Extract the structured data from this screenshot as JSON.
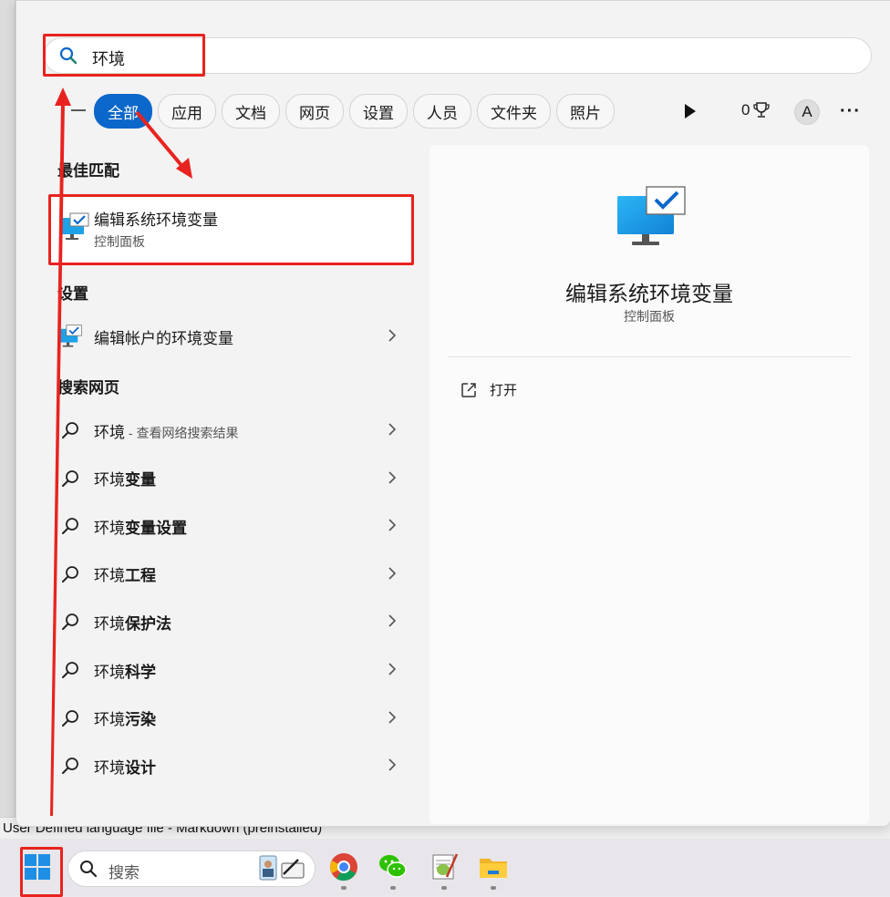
{
  "search": {
    "query": "环境"
  },
  "filters": {
    "back_icon": "back-arrow-icon",
    "chips": [
      "全部",
      "应用",
      "文档",
      "网页",
      "设置",
      "人员",
      "文件夹",
      "照片"
    ],
    "points": "0",
    "avatar": "A",
    "more": "···"
  },
  "sections": {
    "best": "最佳匹配",
    "settings": "设置",
    "web": "搜索网页"
  },
  "best_match": {
    "title": "编辑系统环境变量",
    "subtitle": "控制面板"
  },
  "settings_items": [
    {
      "label": "编辑帐户的环境变量"
    }
  ],
  "web_items": [
    {
      "prefix": "环境",
      "bold": "",
      "hint": " - 查看网络搜索结果"
    },
    {
      "prefix": "环境",
      "bold": "变量",
      "hint": ""
    },
    {
      "prefix": "环境",
      "bold": "变量设置",
      "hint": ""
    },
    {
      "prefix": "环境",
      "bold": "工程",
      "hint": ""
    },
    {
      "prefix": "环境",
      "bold": "保护法",
      "hint": ""
    },
    {
      "prefix": "环境",
      "bold": "科学",
      "hint": ""
    },
    {
      "prefix": "环境",
      "bold": "污染",
      "hint": ""
    },
    {
      "prefix": "环境",
      "bold": "设计",
      "hint": ""
    }
  ],
  "detail": {
    "title": "编辑系统环境变量",
    "category": "控制面板",
    "open_label": "打开"
  },
  "background": {
    "status_text": "User Defined language file - Markdown (preinstalled)"
  },
  "taskbar": {
    "search_label": "搜索"
  },
  "colors": {
    "accent": "#0b67c9",
    "annotation": "#e8231f"
  }
}
